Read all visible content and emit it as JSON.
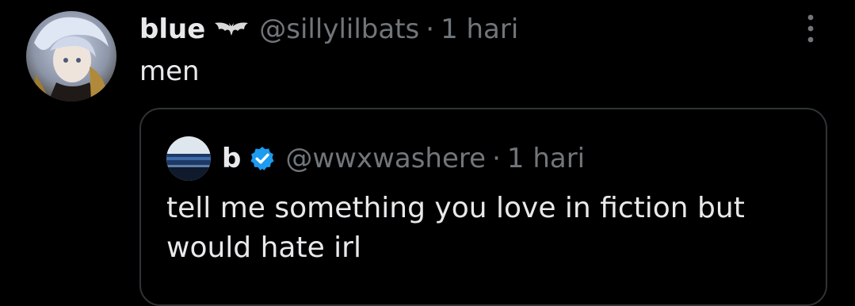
{
  "post": {
    "display_name": "blue",
    "badge_icon": "bat-icon",
    "handle": "@sillylilbats",
    "separator": "·",
    "time": "1 hari",
    "text": "men",
    "more_icon": "more-options-icon"
  },
  "quoted_post": {
    "display_name": "b",
    "verified_icon": "verified-badge-icon",
    "handle": "@wwxwashere",
    "separator": "·",
    "time": "1 hari",
    "text": "tell me something you love in fiction but would hate irl"
  },
  "colors": {
    "background": "#000000",
    "primary_text": "#e7e9ea",
    "secondary_text": "#71767b",
    "border": "#2f3336",
    "verified": "#1d9bf0"
  }
}
